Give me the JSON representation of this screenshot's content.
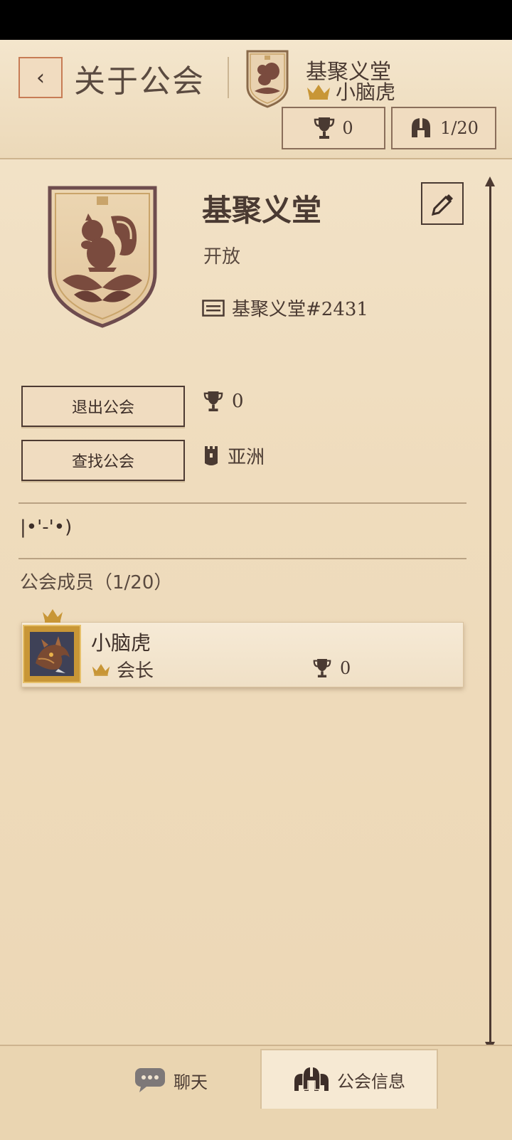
{
  "header": {
    "title": "关于公会",
    "guild_name": "基聚义堂",
    "leader_name": "小脑虎",
    "trophies": "0",
    "members": "1/20"
  },
  "guild": {
    "name": "基聚义堂",
    "status": "开放",
    "tag": "基聚义堂#2431",
    "trophies": "0",
    "region": "亚洲",
    "motto": "|•'-'•)"
  },
  "buttons": {
    "leave": "退出公会",
    "find": "查找公会"
  },
  "members": {
    "title": "公会成员（1/20）",
    "list": [
      {
        "name": "小脑虎",
        "role": "会长",
        "trophies": "0"
      }
    ]
  },
  "nav": {
    "chat": "聊天",
    "guild_info": "公会信息"
  },
  "colors": {
    "parchment": "#f0dfc3",
    "ink": "#4a3a32",
    "gold": "#c89636",
    "accent": "#c77c55"
  }
}
